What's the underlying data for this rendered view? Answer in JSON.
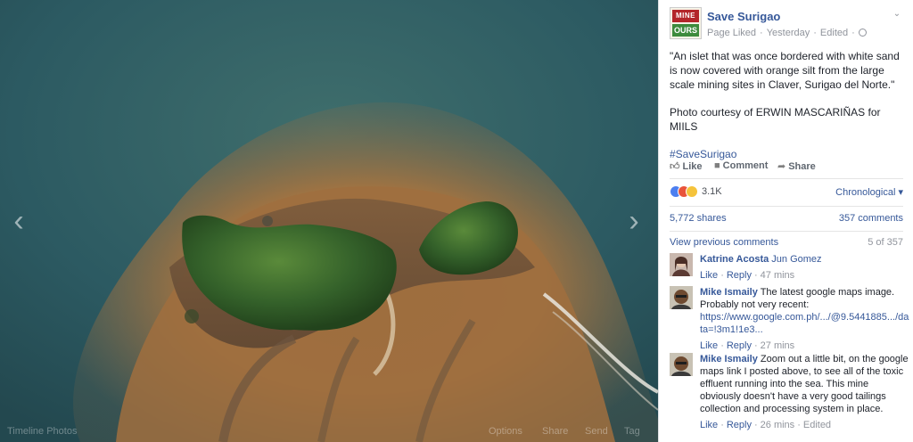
{
  "stage": {
    "footer": {
      "album": "Timeline Photos",
      "options": "Options",
      "share": "Share",
      "send": "Send",
      "tag": "Tag"
    }
  },
  "post": {
    "page_name": "Save Surigao",
    "logo_top": "MINE",
    "logo_bottom": "OURS",
    "meta": {
      "liked": "Page Liked",
      "time": "Yesterday",
      "edited": "Edited"
    },
    "text_quote": "\"An islet that was once bordered with white sand is now covered with orange silt from the large scale mining sites in Claver, Surigao del Norte.\"",
    "text_credit": "Photo courtesy of ERWIN MASCARIÑAS for MIILS",
    "hashtag": "#SaveSurigao",
    "actions": {
      "like": "Like",
      "comment": "Comment",
      "share": "Share"
    },
    "reactions": {
      "count": "3.1K",
      "order": "Chronological"
    },
    "stats": {
      "shares": "5,772 shares",
      "comments": "357 comments"
    },
    "view_previous": {
      "label": "View previous comments",
      "count": "5 of 357"
    }
  },
  "comments": [
    {
      "author": "Katrine Acosta",
      "tag": "Jun Gomez",
      "text": "",
      "link": "",
      "like": "Like",
      "reply": "Reply",
      "time": "47 mins",
      "edited": ""
    },
    {
      "author": "Mike Ismaily",
      "tag": "",
      "text": "The latest google maps image. Probably not very recent:",
      "link": "https://www.google.com.ph/.../@9.5441885.../data=!3m1!1e3...",
      "like": "Like",
      "reply": "Reply",
      "time": "27 mins",
      "edited": ""
    },
    {
      "author": "Mike Ismaily",
      "tag": "",
      "text": "Zoom out a little bit, on the google maps link I posted above, to see all of the toxic effluent running into the sea. This mine obviously doesn't have a very good tailings collection and processing system in place.",
      "link": "",
      "like": "Like",
      "reply": "Reply",
      "time": "26 mins",
      "edited": "Edited"
    }
  ],
  "colors": {
    "link": "#365899",
    "muted": "#90949c",
    "sea": "#2e5d66",
    "silt": "#b07a45",
    "island": "#2f5a24"
  },
  "icons": {
    "nav_prev": "chevron-left-icon",
    "nav_next": "chevron-right-icon",
    "globe": "globe-icon",
    "menu": "chevron-down-icon",
    "like": "thumbs-up-icon",
    "comment": "speech-bubble-icon",
    "share": "share-arrow-icon"
  }
}
